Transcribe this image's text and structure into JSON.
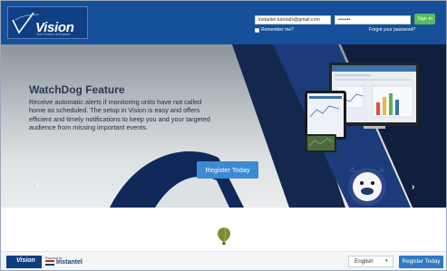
{
  "brand": {
    "logo_word": "Vision",
    "logo_tagline": "The Future of Events"
  },
  "login": {
    "email_value": "instantel.tutorials@gmail.com",
    "password_value": "•••••••",
    "signin_label": "Sign in",
    "remember_label": "Remember me?",
    "forgot_label": "Forgot your password?"
  },
  "hero": {
    "title": "WatchDog Feature",
    "description": "Receive automatic alerts if monitoring units have not called home as scheduled. The setup in Vision is easy and offers efficient and timely notifications to keep you and your targeted audience from missing important events.",
    "register_label": "Register Today",
    "prev_glyph": "‹",
    "next_glyph": "›"
  },
  "footer": {
    "logo_word": "Vision",
    "powered_by": "Powered by",
    "partner_name": "Instantel",
    "language": "English",
    "language_caret": "▾",
    "register_label": "Register Today"
  },
  "colors": {
    "header_bg": "#17509a",
    "signin_bg": "#5cb85c",
    "cta_bg": "#3c8ad3",
    "footer_cta_bg": "#2f78c4"
  }
}
